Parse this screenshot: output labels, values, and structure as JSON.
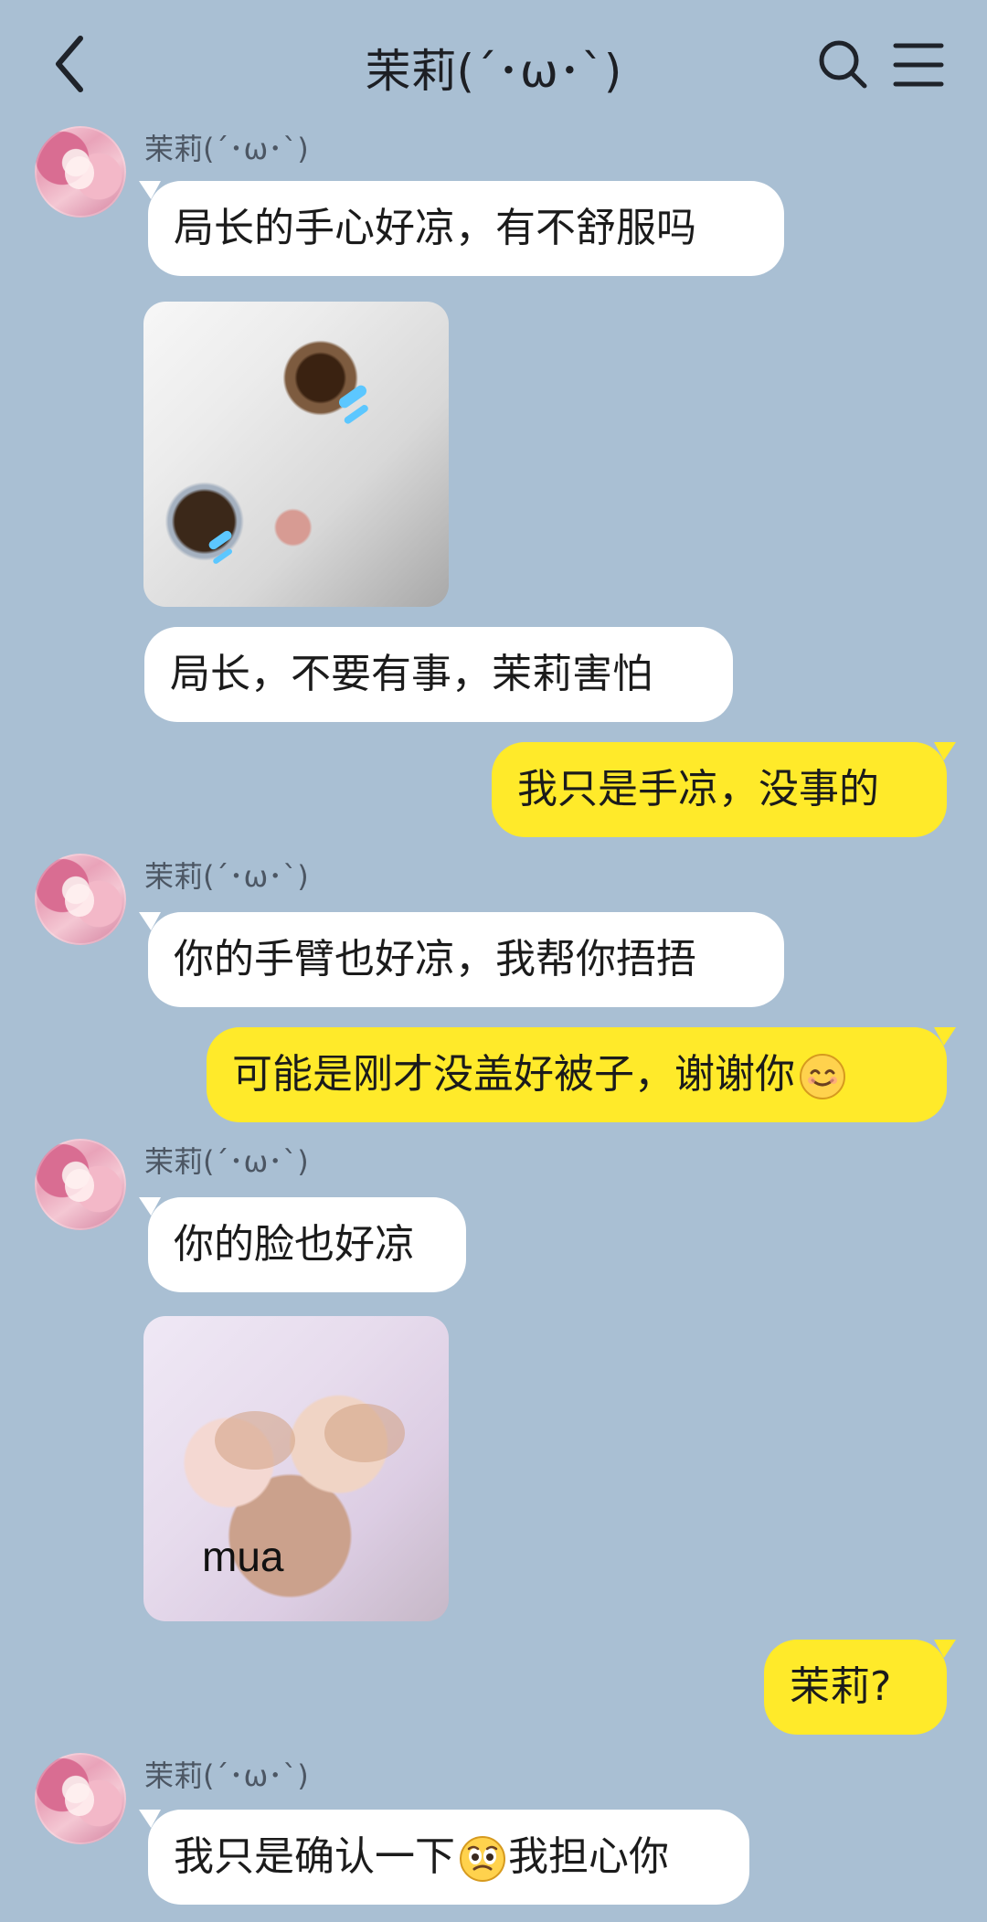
{
  "header": {
    "title": "茉莉(´･ω･`)"
  },
  "messages": [
    {
      "id": "m1",
      "sender": "茉莉(´･ω･`)",
      "text": "局长的手心好凉，有不舒服吗"
    },
    {
      "id": "m2",
      "sticker": "cat-tears"
    },
    {
      "id": "m3",
      "text": "局长，不要有事，茉莉害怕"
    },
    {
      "id": "m4",
      "text": "我只是手凉，没事的"
    },
    {
      "id": "m5",
      "sender": "茉莉(´･ω･`)",
      "text": "你的手臂也好凉，我帮你捂捂"
    },
    {
      "id": "m6",
      "text": "可能是刚才没盖好被子，谢谢你"
    },
    {
      "id": "m7",
      "sender": "茉莉(´･ω･`)",
      "text": "你的脸也好凉"
    },
    {
      "id": "m8",
      "sticker": "kittens-kiss",
      "caption": "mua"
    },
    {
      "id": "m9",
      "text": "茉莉?"
    },
    {
      "id": "m10",
      "sender": "茉莉(´･ω･`)",
      "text_before": "我只是确认一下",
      "text_after": "我担心你"
    }
  ],
  "icons": {
    "back": "chevron-left-icon",
    "search": "search-icon",
    "menu": "menu-icon",
    "smile": "smile-emoji",
    "pleading": "pleading-emoji"
  }
}
